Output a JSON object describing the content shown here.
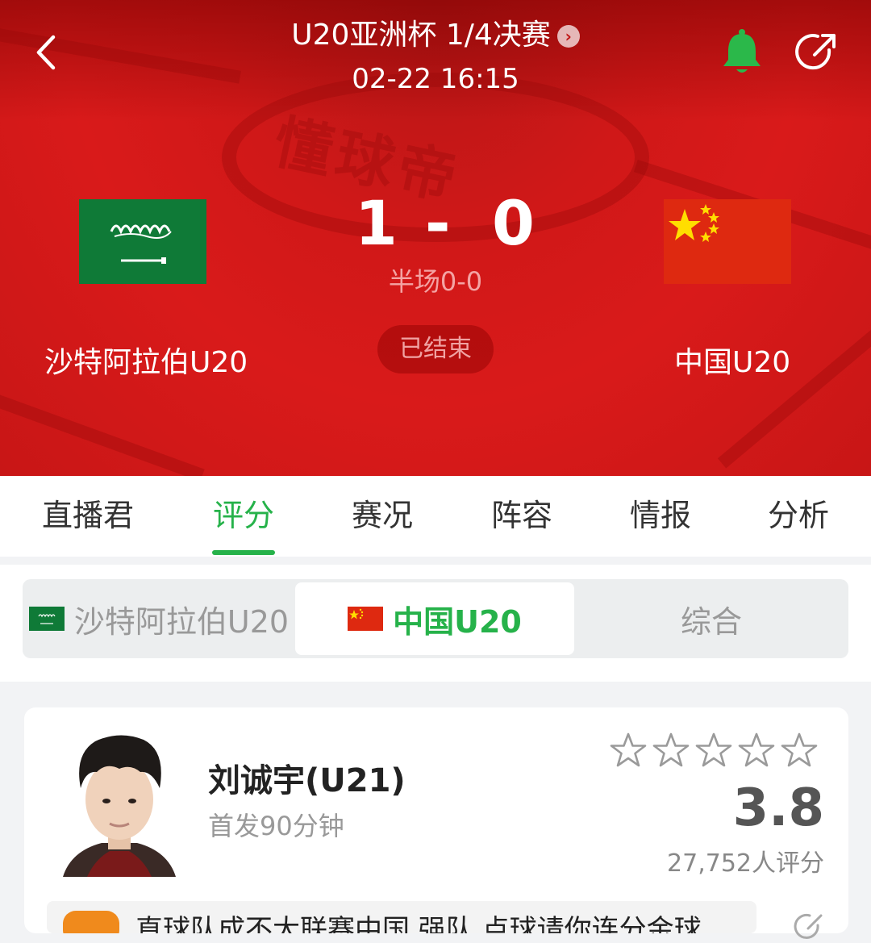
{
  "header": {
    "competition": "U20亚洲杯 1/4决赛",
    "datetime": "02-22 16:15",
    "watermark": "懂球帝"
  },
  "match": {
    "home": {
      "name": "沙特阿拉伯U20",
      "score": "1"
    },
    "away": {
      "name": "中国U20",
      "score": "0"
    },
    "dash": "-",
    "halftime": "半场0-0",
    "status": "已结束"
  },
  "tabs": [
    {
      "label": "直播君"
    },
    {
      "label": "评分"
    },
    {
      "label": "赛况"
    },
    {
      "label": "阵容"
    },
    {
      "label": "情报"
    },
    {
      "label": "分析"
    }
  ],
  "team_switch": {
    "home": "沙特阿拉伯U20",
    "away": "中国U20",
    "overall": "综合"
  },
  "player": {
    "name": "刘诚宇(U21)",
    "sub": "首发90分钟",
    "rating": "3.8",
    "rating_count": "27,752人评分",
    "stars_filled": 0,
    "comment": "直球队成不大联赛中国 强队 点球请你连分金球"
  },
  "colors": {
    "accent": "#26b24a",
    "header_red": "#d01818",
    "saudi_green": "#0f7a37",
    "china_red": "#de2910",
    "bell_green": "#2bb84a"
  }
}
